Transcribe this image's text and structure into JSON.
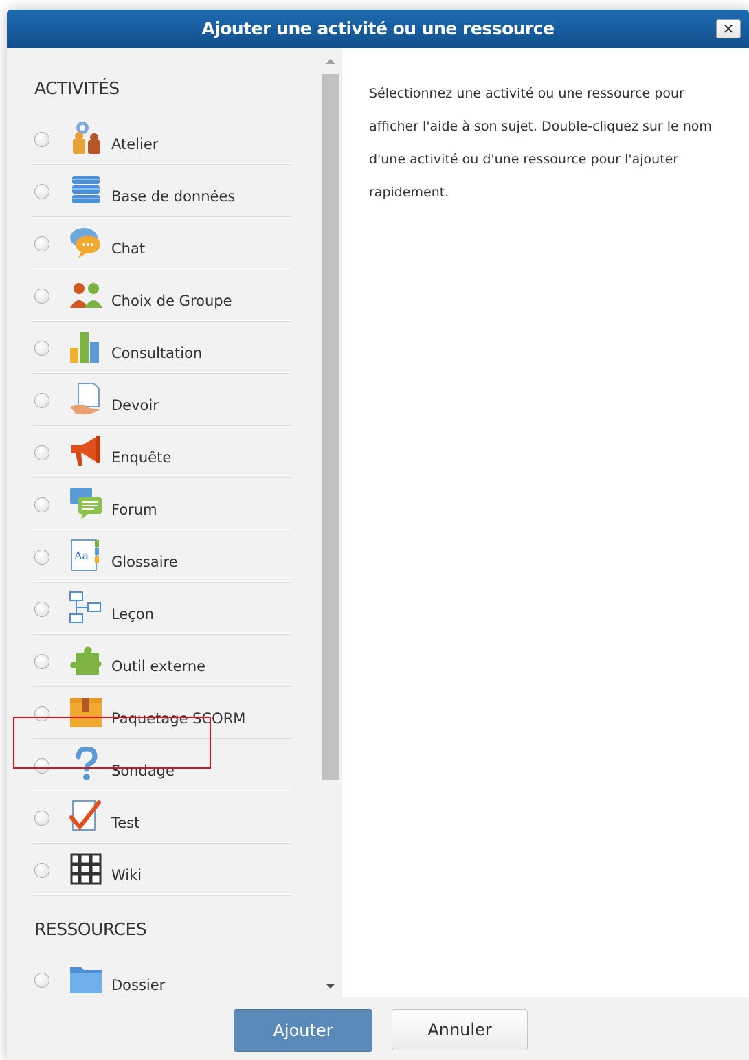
{
  "dialog": {
    "title": "Ajouter une activité ou une ressource",
    "close_label": "✕"
  },
  "sections": {
    "activities_title": "ACTIVITÉS",
    "resources_title": "RESSOURCES"
  },
  "activities": [
    {
      "label": "Atelier",
      "icon": "workshop-icon"
    },
    {
      "label": "Base de données",
      "icon": "database-icon"
    },
    {
      "label": "Chat",
      "icon": "chat-icon"
    },
    {
      "label": "Choix de Groupe",
      "icon": "group-choice-icon"
    },
    {
      "label": "Consultation",
      "icon": "consultation-chart-icon"
    },
    {
      "label": "Devoir",
      "icon": "assignment-icon"
    },
    {
      "label": "Enquête",
      "icon": "megaphone-icon"
    },
    {
      "label": "Forum",
      "icon": "forum-icon"
    },
    {
      "label": "Glossaire",
      "icon": "glossary-icon"
    },
    {
      "label": "Leçon",
      "icon": "lesson-icon"
    },
    {
      "label": "Outil externe",
      "icon": "puzzle-icon"
    },
    {
      "label": "Paquetage SCORM",
      "icon": "scorm-package-icon"
    },
    {
      "label": "Sondage",
      "icon": "question-mark-icon"
    },
    {
      "label": "Test",
      "icon": "quiz-check-icon"
    },
    {
      "label": "Wiki",
      "icon": "wiki-icon"
    }
  ],
  "resources": [
    {
      "label": "Dossier",
      "icon": "folder-icon"
    }
  ],
  "help": {
    "text": "Sélectionnez une activité ou une ressource pour afficher l'aide à son sujet. Double-cliquez sur le nom d'une activité ou d'une ressource pour l'ajouter rapidement."
  },
  "footer": {
    "add_label": "Ajouter",
    "cancel_label": "Annuler"
  },
  "colors": {
    "titlebar": "#1a5fa0",
    "add_button": "#5b8ab9",
    "highlight": "#e0101a"
  }
}
